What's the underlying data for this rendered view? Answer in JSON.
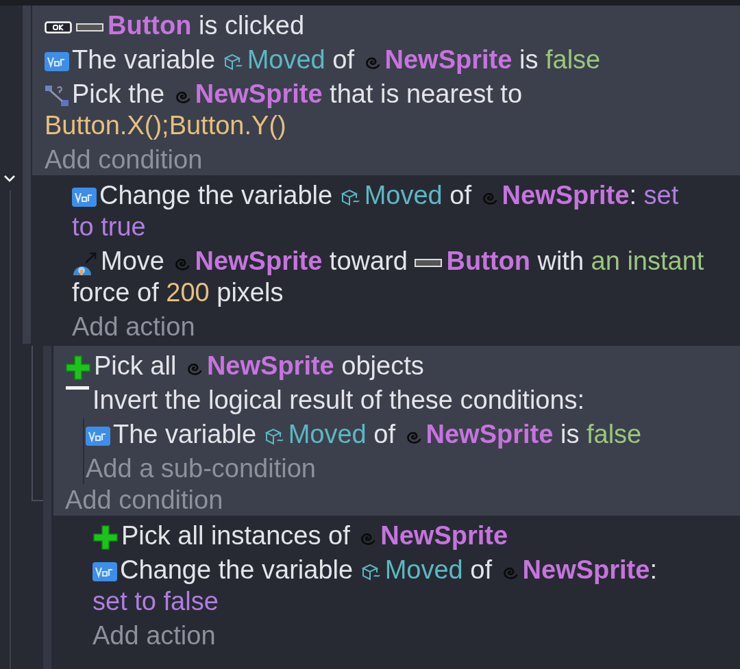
{
  "events": [
    {
      "expanded": true,
      "conditions": [
        {
          "kind": "button-clicked",
          "parts": [
            {
              "kind": "widget",
              "text": "Button"
            },
            {
              "kind": "text",
              "text": " is clicked"
            }
          ]
        },
        {
          "kind": "variable",
          "parts": [
            {
              "kind": "text",
              "text": "The variable "
            },
            {
              "kind": "variable",
              "text": "Moved"
            },
            {
              "kind": "text",
              "text": " of "
            },
            {
              "kind": "sprite",
              "text": "NewSprite"
            },
            {
              "kind": "text",
              "text": " is "
            },
            {
              "kind": "value",
              "text": "false"
            }
          ]
        },
        {
          "kind": "pick-nearest",
          "parts": [
            {
              "kind": "text",
              "text": "Pick the "
            },
            {
              "kind": "sprite",
              "text": "NewSprite"
            },
            {
              "kind": "text",
              "text": " that is nearest to "
            },
            {
              "kind": "expression",
              "text": "Button.X();Button.Y()"
            }
          ]
        }
      ],
      "add_condition": "Add condition",
      "actions": [
        {
          "kind": "variable",
          "parts": [
            {
              "kind": "text",
              "text": "Change the variable "
            },
            {
              "kind": "variable",
              "text": "Moved"
            },
            {
              "kind": "text",
              "text": " of "
            },
            {
              "kind": "sprite",
              "text": "NewSprite"
            },
            {
              "kind": "text",
              "text": ": "
            },
            {
              "kind": "operation",
              "text": "set"
            },
            {
              "kind": "operation",
              "text": "to true"
            }
          ]
        },
        {
          "kind": "move-toward",
          "parts": [
            {
              "kind": "text",
              "text": "Move "
            },
            {
              "kind": "sprite",
              "text": "NewSprite"
            },
            {
              "kind": "text",
              "text": " toward "
            },
            {
              "kind": "widget",
              "text": "Button"
            },
            {
              "kind": "text",
              "text": " with "
            },
            {
              "kind": "value",
              "text": "an"
            },
            {
              "kind": "value",
              "text": "instant"
            },
            {
              "kind": "text",
              "text": " force of "
            },
            {
              "kind": "expression",
              "text": "200"
            },
            {
              "kind": "text",
              "text": " pixels"
            }
          ]
        }
      ],
      "add_action": "Add action",
      "children": [
        {
          "conditions": [
            {
              "kind": "pick-all",
              "parts": [
                {
                  "kind": "text",
                  "text": "Pick all "
                },
                {
                  "kind": "sprite",
                  "text": "NewSprite"
                },
                {
                  "kind": "text",
                  "text": " objects"
                }
              ]
            },
            {
              "kind": "invert",
              "parts": [
                {
                  "kind": "text",
                  "text": "Invert the logical result of these conditions:"
                }
              ],
              "children": [
                {
                  "kind": "variable",
                  "parts": [
                    {
                      "kind": "text",
                      "text": "The variable "
                    },
                    {
                      "kind": "variable",
                      "text": "Moved"
                    },
                    {
                      "kind": "text",
                      "text": " of "
                    },
                    {
                      "kind": "sprite",
                      "text": "NewSprite"
                    },
                    {
                      "kind": "text",
                      "text": " is "
                    },
                    {
                      "kind": "value",
                      "text": "false"
                    }
                  ]
                }
              ],
              "add_sub_condition": "Add a sub-condition"
            }
          ],
          "add_condition": "Add condition",
          "actions": [
            {
              "kind": "pick-all",
              "parts": [
                {
                  "kind": "text",
                  "text": "Pick all instances of "
                },
                {
                  "kind": "sprite",
                  "text": "NewSprite"
                }
              ]
            },
            {
              "kind": "variable",
              "parts": [
                {
                  "kind": "text",
                  "text": "Change the variable "
                },
                {
                  "kind": "variable",
                  "text": "Moved"
                },
                {
                  "kind": "text",
                  "text": " of "
                },
                {
                  "kind": "sprite",
                  "text": "NewSprite"
                },
                {
                  "kind": "text",
                  "text": ": "
                },
                {
                  "kind": "operation",
                  "text": "set to false"
                }
              ]
            }
          ],
          "add_action": "Add action"
        }
      ]
    }
  ]
}
